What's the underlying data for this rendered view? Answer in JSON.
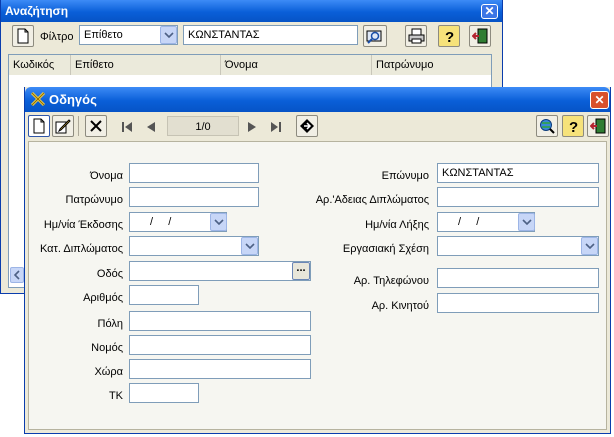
{
  "search_window": {
    "title": "Αναζήτηση",
    "filter_label": "Φίλτρο",
    "filter_select_value": "Επίθετο",
    "search_value": "ΚΩΝΣΤΑΝΤΑΣ",
    "columns": [
      "Κωδικός",
      "Επίθετο",
      "Όνομα",
      "Πατρώνυμο"
    ]
  },
  "driver_window": {
    "title": "Οδηγός",
    "record_counter": "1/0",
    "fields": {
      "first_name": {
        "label": "Όνομα",
        "value": ""
      },
      "father_name": {
        "label": "Πατρώνυμο",
        "value": ""
      },
      "issue_date": {
        "label": "Ημ/νία Έκδοσης",
        "value": " /  /"
      },
      "license_category": {
        "label": "Κατ. Διπλώματος",
        "value": ""
      },
      "street": {
        "label": "Οδός",
        "value": ""
      },
      "number": {
        "label": "Αριθμός",
        "value": ""
      },
      "city": {
        "label": "Πόλη",
        "value": ""
      },
      "prefecture": {
        "label": "Νομός",
        "value": ""
      },
      "country": {
        "label": "Χώρα",
        "value": ""
      },
      "postal_code": {
        "label": "ΤΚ",
        "value": ""
      },
      "last_name": {
        "label": "Επώνυμο",
        "value": "ΚΩΝΣΤΑΝΤΑΣ"
      },
      "license_number": {
        "label": "Αρ.'Αδειας Διπλώματος",
        "value": ""
      },
      "expiry_date": {
        "label": "Ημ/νία Λήξης",
        "value": " /  /"
      },
      "employment_relation": {
        "label": "Εργασιακή Σχέση",
        "value": ""
      },
      "phone": {
        "label": "Αρ. Τηλεφώνου",
        "value": ""
      },
      "mobile": {
        "label": "Αρ. Κινητού",
        "value": ""
      }
    }
  },
  "colors": {
    "titlebar_blue": "#0a5fd8",
    "window_face": "#ece9d8",
    "form_panel": "#f6f6f1",
    "close_red": "#d8502c"
  }
}
